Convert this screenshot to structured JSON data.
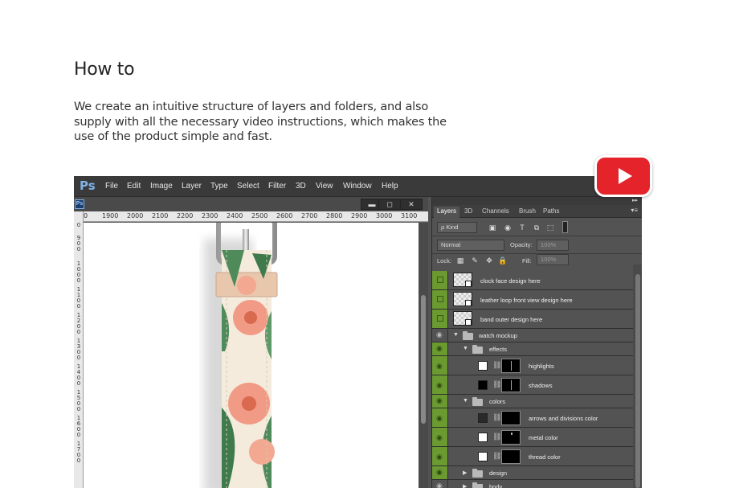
{
  "heading": "How to",
  "description": "We create an intuitive structure of layers and folders, and also supply with all the necessary video instructions, which makes the use of the product simple and fast.",
  "youtube": {
    "icon": "play-icon"
  },
  "ps": {
    "logo": "Ps",
    "menu": [
      "File",
      "Edit",
      "Image",
      "Layer",
      "Type",
      "Select",
      "Filter",
      "3D",
      "View",
      "Window",
      "Help"
    ],
    "doc": {
      "icon_label": "Ps",
      "window_buttons": [
        "▬",
        "◻",
        "✕"
      ],
      "ruler_top": [
        "0",
        "1900",
        "2000",
        "2100",
        "2200",
        "2300",
        "2400",
        "2500",
        "2600",
        "2700",
        "2800",
        "2900",
        "3000",
        "3100"
      ],
      "ruler_left": [
        "0",
        "9\n0\n0",
        "1\n0\n0\n0",
        "1\n1\n0\n0",
        "1\n2\n0\n0",
        "1\n3\n0\n0",
        "1\n4\n0\n0",
        "1\n5\n0\n0",
        "1\n6\n0\n0",
        "1\n7\n0\n0"
      ]
    },
    "panel": {
      "collapse": "▸▸",
      "tabs": [
        "Layers",
        "3D",
        "Channels",
        "Brush",
        "Paths"
      ],
      "tab_menu": "▾≡",
      "filter_label": "ρ Kind",
      "filter_icons": [
        "▣",
        "◉",
        "T",
        "⧉",
        "⬚"
      ],
      "blend_mode": "Normal",
      "opacity_label": "Opacity:",
      "opacity_value": "100%",
      "lock_label": "Lock:",
      "lock_icons": [
        "▦",
        "✎",
        "✥",
        "🔒"
      ],
      "fill_label": "Fill:",
      "fill_value": "100%",
      "layers": [
        {
          "name": "clock face design here"
        },
        {
          "name": "leather loop front view design here"
        },
        {
          "name": "band outer design here"
        },
        {
          "name": "watch mockup"
        },
        {
          "name": "effects"
        },
        {
          "name": "highlights"
        },
        {
          "name": "shadows"
        },
        {
          "name": "colors"
        },
        {
          "name": "arrows and divisions color"
        },
        {
          "name": "metal color"
        },
        {
          "name": "thread color"
        },
        {
          "name": "design"
        },
        {
          "name": "body"
        }
      ]
    }
  },
  "colors": {
    "youtube_red": "#e4232a",
    "ps_menubar": "#3a3a3a",
    "visibility_green": "#6a9a30",
    "strap_cream": "#f4ebdc",
    "flower_pink": "#f19a85",
    "leaf_green": "#4f8a5a"
  }
}
